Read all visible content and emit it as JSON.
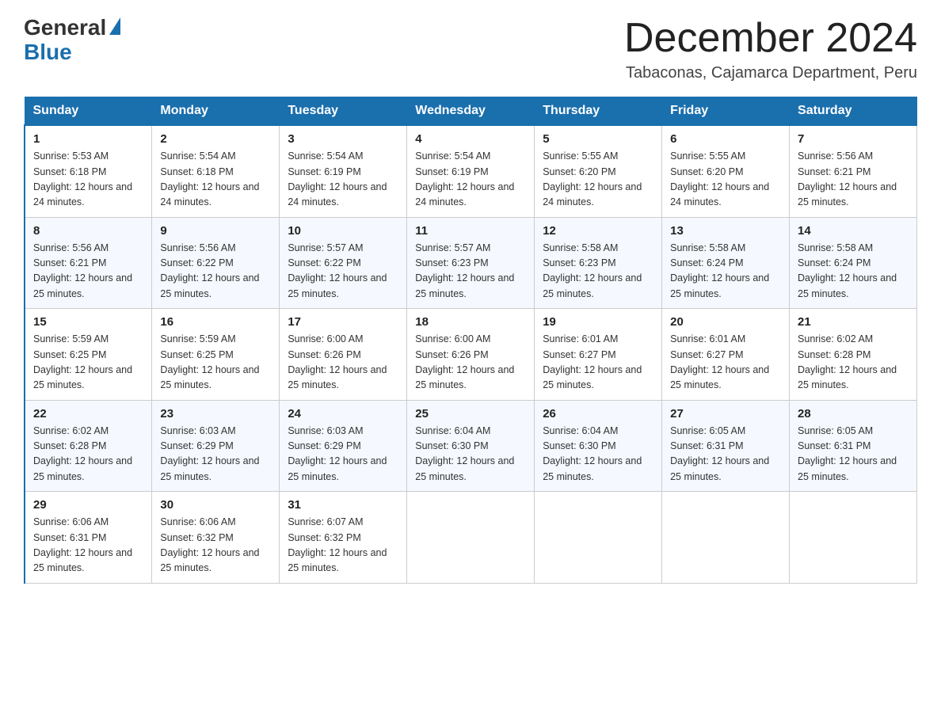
{
  "header": {
    "logo_general": "General",
    "logo_blue": "Blue",
    "month_title": "December 2024",
    "subtitle": "Tabaconas, Cajamarca Department, Peru"
  },
  "days_of_week": [
    "Sunday",
    "Monday",
    "Tuesday",
    "Wednesday",
    "Thursday",
    "Friday",
    "Saturday"
  ],
  "weeks": [
    [
      {
        "day": "1",
        "sunrise": "5:53 AM",
        "sunset": "6:18 PM",
        "daylight": "12 hours and 24 minutes."
      },
      {
        "day": "2",
        "sunrise": "5:54 AM",
        "sunset": "6:18 PM",
        "daylight": "12 hours and 24 minutes."
      },
      {
        "day": "3",
        "sunrise": "5:54 AM",
        "sunset": "6:19 PM",
        "daylight": "12 hours and 24 minutes."
      },
      {
        "day": "4",
        "sunrise": "5:54 AM",
        "sunset": "6:19 PM",
        "daylight": "12 hours and 24 minutes."
      },
      {
        "day": "5",
        "sunrise": "5:55 AM",
        "sunset": "6:20 PM",
        "daylight": "12 hours and 24 minutes."
      },
      {
        "day": "6",
        "sunrise": "5:55 AM",
        "sunset": "6:20 PM",
        "daylight": "12 hours and 24 minutes."
      },
      {
        "day": "7",
        "sunrise": "5:56 AM",
        "sunset": "6:21 PM",
        "daylight": "12 hours and 25 minutes."
      }
    ],
    [
      {
        "day": "8",
        "sunrise": "5:56 AM",
        "sunset": "6:21 PM",
        "daylight": "12 hours and 25 minutes."
      },
      {
        "day": "9",
        "sunrise": "5:56 AM",
        "sunset": "6:22 PM",
        "daylight": "12 hours and 25 minutes."
      },
      {
        "day": "10",
        "sunrise": "5:57 AM",
        "sunset": "6:22 PM",
        "daylight": "12 hours and 25 minutes."
      },
      {
        "day": "11",
        "sunrise": "5:57 AM",
        "sunset": "6:23 PM",
        "daylight": "12 hours and 25 minutes."
      },
      {
        "day": "12",
        "sunrise": "5:58 AM",
        "sunset": "6:23 PM",
        "daylight": "12 hours and 25 minutes."
      },
      {
        "day": "13",
        "sunrise": "5:58 AM",
        "sunset": "6:24 PM",
        "daylight": "12 hours and 25 minutes."
      },
      {
        "day": "14",
        "sunrise": "5:58 AM",
        "sunset": "6:24 PM",
        "daylight": "12 hours and 25 minutes."
      }
    ],
    [
      {
        "day": "15",
        "sunrise": "5:59 AM",
        "sunset": "6:25 PM",
        "daylight": "12 hours and 25 minutes."
      },
      {
        "day": "16",
        "sunrise": "5:59 AM",
        "sunset": "6:25 PM",
        "daylight": "12 hours and 25 minutes."
      },
      {
        "day": "17",
        "sunrise": "6:00 AM",
        "sunset": "6:26 PM",
        "daylight": "12 hours and 25 minutes."
      },
      {
        "day": "18",
        "sunrise": "6:00 AM",
        "sunset": "6:26 PM",
        "daylight": "12 hours and 25 minutes."
      },
      {
        "day": "19",
        "sunrise": "6:01 AM",
        "sunset": "6:27 PM",
        "daylight": "12 hours and 25 minutes."
      },
      {
        "day": "20",
        "sunrise": "6:01 AM",
        "sunset": "6:27 PM",
        "daylight": "12 hours and 25 minutes."
      },
      {
        "day": "21",
        "sunrise": "6:02 AM",
        "sunset": "6:28 PM",
        "daylight": "12 hours and 25 minutes."
      }
    ],
    [
      {
        "day": "22",
        "sunrise": "6:02 AM",
        "sunset": "6:28 PM",
        "daylight": "12 hours and 25 minutes."
      },
      {
        "day": "23",
        "sunrise": "6:03 AM",
        "sunset": "6:29 PM",
        "daylight": "12 hours and 25 minutes."
      },
      {
        "day": "24",
        "sunrise": "6:03 AM",
        "sunset": "6:29 PM",
        "daylight": "12 hours and 25 minutes."
      },
      {
        "day": "25",
        "sunrise": "6:04 AM",
        "sunset": "6:30 PM",
        "daylight": "12 hours and 25 minutes."
      },
      {
        "day": "26",
        "sunrise": "6:04 AM",
        "sunset": "6:30 PM",
        "daylight": "12 hours and 25 minutes."
      },
      {
        "day": "27",
        "sunrise": "6:05 AM",
        "sunset": "6:31 PM",
        "daylight": "12 hours and 25 minutes."
      },
      {
        "day": "28",
        "sunrise": "6:05 AM",
        "sunset": "6:31 PM",
        "daylight": "12 hours and 25 minutes."
      }
    ],
    [
      {
        "day": "29",
        "sunrise": "6:06 AM",
        "sunset": "6:31 PM",
        "daylight": "12 hours and 25 minutes."
      },
      {
        "day": "30",
        "sunrise": "6:06 AM",
        "sunset": "6:32 PM",
        "daylight": "12 hours and 25 minutes."
      },
      {
        "day": "31",
        "sunrise": "6:07 AM",
        "sunset": "6:32 PM",
        "daylight": "12 hours and 25 minutes."
      },
      null,
      null,
      null,
      null
    ]
  ],
  "labels": {
    "sunrise": "Sunrise:",
    "sunset": "Sunset:",
    "daylight": "Daylight:"
  }
}
